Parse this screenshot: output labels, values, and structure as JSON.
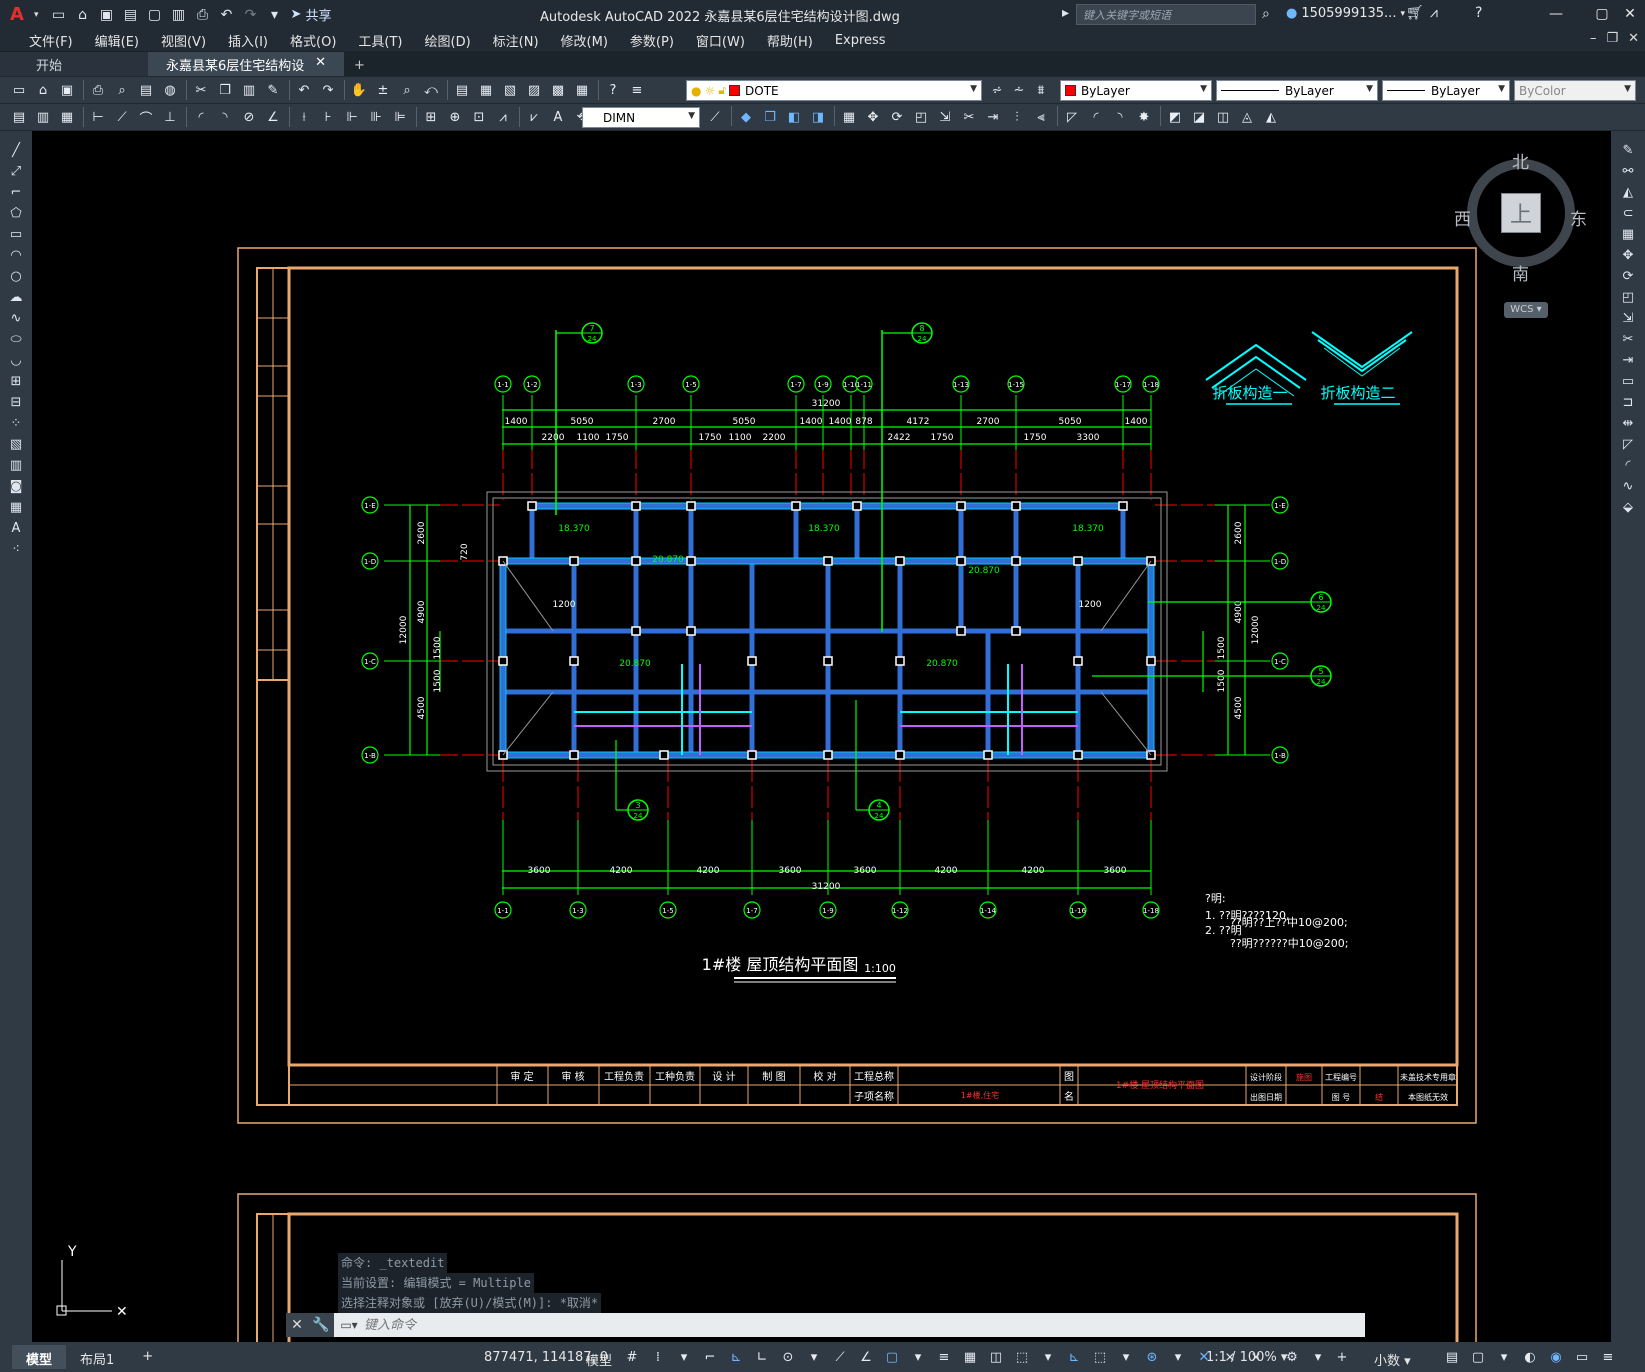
{
  "app": {
    "logo": "A",
    "title": "Autodesk AutoCAD 2022    永嘉县某6层住宅结构设计图.dwg",
    "share_label": "共享",
    "search_placeholder": "键入关键字或短语",
    "user": "1505999135..."
  },
  "menu": [
    "文件(F)",
    "编辑(E)",
    "视图(V)",
    "插入(I)",
    "格式(O)",
    "工具(T)",
    "绘图(D)",
    "标注(N)",
    "修改(M)",
    "参数(P)",
    "窗口(W)",
    "帮助(H)",
    "Express"
  ],
  "tabs": {
    "start": "开始",
    "doc": "永嘉县某6层住宅结构设计图*",
    "close": "✕",
    "add": "+"
  },
  "toolbar": {
    "layer": "DOTE",
    "color": "ByLayer",
    "linetype": "ByLayer",
    "lineweight": "ByLayer",
    "plotstyle": "ByColor",
    "dimstyle": "DIMN",
    "layer_color": "#ff0000"
  },
  "viewcube": {
    "north": "北",
    "south": "南",
    "east": "东",
    "west": "西",
    "face": "上",
    "wcs": "WCS"
  },
  "drawing": {
    "title": "1#楼 屋顶结构平面图",
    "scale": "1:100",
    "note_head": "?明:",
    "note1": "1. ??明????120,",
    "note1b": "??明??上??中10@200;",
    "note2": "2. ??明",
    "note2b": "??明??????中10@200;",
    "detail1": "折板构造一",
    "detail2": "折板构造二",
    "axes_top": [
      "1-1",
      "1-2",
      "1-3",
      "1-5",
      "1-7",
      "1-9",
      "1-10",
      "1-11",
      "1-13",
      "1-15",
      "1-17",
      "1-18"
    ],
    "axes_bottom": [
      "1-1",
      "1-3",
      "1-5",
      "1-7",
      "1-9",
      "1-12",
      "1-14",
      "1-16",
      "1-18"
    ],
    "axes_left": [
      "1-E",
      "1-D",
      "1-C",
      "1-B"
    ],
    "dims_top_row1": [
      "1400",
      "5050",
      "2700",
      "5050",
      "1400",
      "1400",
      "878",
      "4172",
      "2700",
      "5050",
      "1400"
    ],
    "dims_top_row2": [
      "2200",
      "1100",
      "1750",
      "1750",
      "1100",
      "2200",
      "2422",
      "1750",
      "1750",
      "3300"
    ],
    "dims_bottom": [
      "3600",
      "4200",
      "4200",
      "3600",
      "3600",
      "4200",
      "4200",
      "3600"
    ],
    "total_dim": "31200",
    "dims_left": [
      "2600",
      "4900",
      "4500"
    ],
    "dim_left_total": "12000",
    "dim_mid": [
      "1500",
      "1500"
    ],
    "dim_720": "720",
    "elevations": [
      "18.370",
      "18.370",
      "18.370",
      "20.870",
      "20.870",
      "20.870",
      "20.870"
    ],
    "span_1200": "1200",
    "section_mark": "24",
    "section_nums": [
      "7",
      "8",
      "6",
      "5",
      "3",
      "4"
    ],
    "title_block": {
      "row1": [
        "审 定",
        "审 核",
        "工程负责",
        "工种负责",
        "设 计",
        "制 图",
        "校 对",
        "工程总称",
        "图",
        "设计阶段",
        "施图",
        "工程编号",
        "未盖技术专用章"
      ],
      "row2": [
        "子项名称",
        "名",
        "出图日期",
        "图 号",
        "结",
        "本图纸无效"
      ],
      "drawing_name": "1#楼 屋顶结构平面图",
      "subproject": "1#楼,住宅"
    }
  },
  "command": {
    "history": [
      "命令: _textedit",
      "当前设置: 编辑模式 = Multiple",
      "选择注释对象或 [放弃(U)/模式(M)]: *取消*"
    ],
    "placeholder": "键入命令",
    "close": "✕",
    "wrench": "🔧",
    "prompt": "▭▾"
  },
  "status": {
    "tabs": [
      "模型",
      "布局1",
      "+"
    ],
    "coords": "877471, 114187, 0",
    "space": "模型",
    "scale": "1:1 / 100%",
    "units": "小数"
  },
  "colors": {
    "green": "#00ff00",
    "cyan": "#00ffff",
    "red": "#ff0000",
    "frame": "#e8a870",
    "magenta": "#c060ff",
    "blue": "#3a7bd5"
  }
}
